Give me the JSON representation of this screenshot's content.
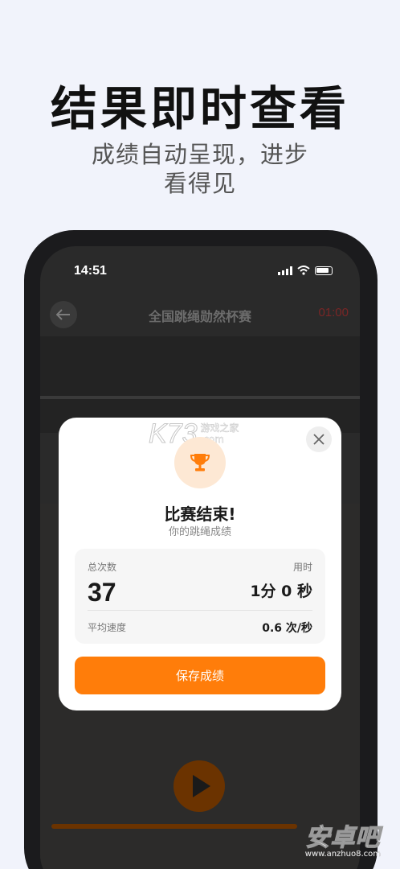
{
  "promo": {
    "headline": "结果即时查看",
    "subline_1": "成绩自动呈现，进步",
    "subline_2": "看得见"
  },
  "status_bar": {
    "time": "14:51"
  },
  "nav": {
    "title": "全国跳绳勋然杯赛",
    "timer": "01:00"
  },
  "modal": {
    "title": "比赛结束!",
    "subtitle": "你的跳绳成绩",
    "total_count_label": "总次数",
    "total_count": "37",
    "duration_label": "用时",
    "duration": "1分 0 秒",
    "avg_speed_label": "平均速度",
    "avg_speed": "0.6 次/秒",
    "save_button": "保存成绩"
  },
  "watermarks": {
    "k73_main": "K73",
    "k73_cn": "游戏之家",
    "k73_url": ".com",
    "anzhuo_main": "安卓吧",
    "anzhuo_url": "www.anzhuo8.com"
  },
  "colors": {
    "accent": "#ff7d0a",
    "background": "#f1f3fb",
    "trophy": "#ff7d0a"
  },
  "icons": [
    "back-arrow-icon",
    "signal-icon",
    "wifi-icon",
    "battery-icon",
    "close-icon",
    "trophy-icon",
    "play-icon"
  ]
}
